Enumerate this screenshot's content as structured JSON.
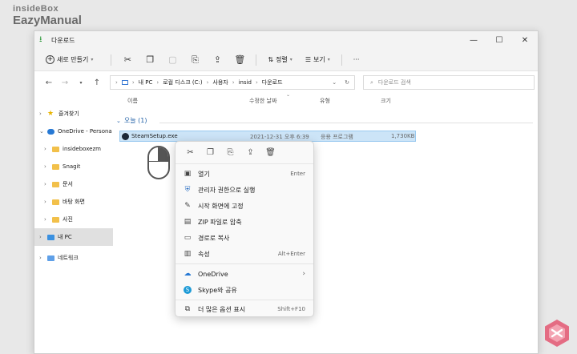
{
  "watermark": {
    "line1": "insideBox",
    "line2": "EazyManual"
  },
  "window": {
    "title": "다운로드",
    "controls": {
      "minimize": "—",
      "maximize": "☐",
      "close": "✕"
    }
  },
  "toolbar": {
    "new_label": "새로 만들기",
    "sort_label": "정렬",
    "view_label": "보기",
    "more_label": "···"
  },
  "address": {
    "crumbs": [
      "내 PC",
      "로컬 디스크 (C:)",
      "사용자",
      "insid",
      "다운로드"
    ],
    "search_placeholder": "다운로드 검색"
  },
  "sidebar": {
    "items": [
      {
        "label": "즐겨찾기"
      },
      {
        "label": "OneDrive - Persona"
      },
      {
        "label": "insideboxezm"
      },
      {
        "label": "Snagit"
      },
      {
        "label": "문서"
      },
      {
        "label": "바탕 화면"
      },
      {
        "label": "사진"
      },
      {
        "label": "내 PC"
      },
      {
        "label": "네트워크"
      }
    ]
  },
  "columns": {
    "name": "이름",
    "modified": "수정한 날짜",
    "type": "유형",
    "size": "크기"
  },
  "group": {
    "label": "오늘 (1)"
  },
  "file": {
    "name": "SteamSetup.exe",
    "modified": "2021-12-31 오후 6:39",
    "type": "응용 프로그램",
    "size": "1,730KB"
  },
  "context_menu": {
    "items": [
      {
        "label": "열기",
        "shortcut": "Enter"
      },
      {
        "label": "관리자 권한으로 실행",
        "shortcut": ""
      },
      {
        "label": "시작 화면에 고정",
        "shortcut": ""
      },
      {
        "label": "ZIP 파일로 압축",
        "shortcut": ""
      },
      {
        "label": "경로로 복사",
        "shortcut": ""
      },
      {
        "label": "속성",
        "shortcut": "Alt+Enter"
      },
      {
        "label": "OneDrive",
        "shortcut": "›"
      },
      {
        "label": "Skype와 공유",
        "shortcut": ""
      },
      {
        "label": "더 많은 옵션 표시",
        "shortcut": "Shift+F10"
      }
    ]
  },
  "colors": {
    "accent": "#0067c0",
    "selection": "#cce4f7",
    "folder": "#f2c04a"
  }
}
